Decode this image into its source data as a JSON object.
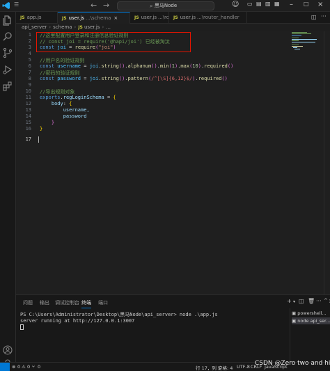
{
  "titlebar": {
    "menu_icon": "hamburger-menu-icon",
    "back": "←",
    "forward": "→",
    "command_center": "黑马Node"
  },
  "activity_icons": [
    "explorer-icon",
    "search-icon",
    "source-control-icon",
    "run-debug-icon",
    "extensions-icon"
  ],
  "tabs": [
    {
      "label": "app.js",
      "desc": "",
      "active": false
    },
    {
      "label": "user.js",
      "desc": "...\\schema",
      "active": true
    },
    {
      "label": "user.js",
      "desc": "...\\router",
      "active": false
    },
    {
      "label": "user.js",
      "desc": "...\\router_handler",
      "active": false
    }
  ],
  "breadcrumbs": [
    "api_server",
    "schema",
    "user.js",
    "..."
  ],
  "editor": {
    "line_numbers": [
      "1",
      "2",
      "3",
      "4",
      "5",
      "6",
      "7",
      "8",
      "9",
      "10",
      "11",
      "12",
      "13",
      "14",
      "15",
      "16",
      "17"
    ],
    "lines": [
      "//这里配置用户登录和注册信息验证规则",
      "// const joi = require('@hapi/joi') 已经被淘汰",
      "const joi = require(\"joi\")",
      "",
      "//用户名的验证规则",
      "const username = joi.string().alphanum().min(1).max(10).required()",
      "//密码的验证规则",
      "const password = joi.string().pattern(/^[\\S]{6,12}$/).required()",
      "",
      "//导出规则对象",
      "exports.regLoginSchema = {",
      "    body: {",
      "        username,",
      "        password",
      "    }",
      "}",
      ""
    ]
  },
  "panel": {
    "tabs": [
      "问题",
      "输出",
      "调试控制台",
      "终端",
      "端口"
    ],
    "active_tab": "终端",
    "terminal_lines": [
      "PS C:\\Users\\Administrator\\Desktop\\黑马Node\\api_server> node .\\app.js",
      "server running at http://127.0.0.1:3007"
    ],
    "terminal_list": [
      {
        "label": "powershell...",
        "selected": false
      },
      {
        "label": "node  api_ser...",
        "selected": true
      }
    ]
  },
  "status": {
    "errors": "0",
    "warnings": "0",
    "ports": "0",
    "position": "行 17，列 1",
    "spaces": "空格: 4",
    "encoding": "UTF-8",
    "eol": "CRLF",
    "language": "JavaScript"
  },
  "watermark": "CSDN @Zero two and hiro",
  "colors": {
    "accent": "#0078d4",
    "highlight_box": "#e51400"
  }
}
